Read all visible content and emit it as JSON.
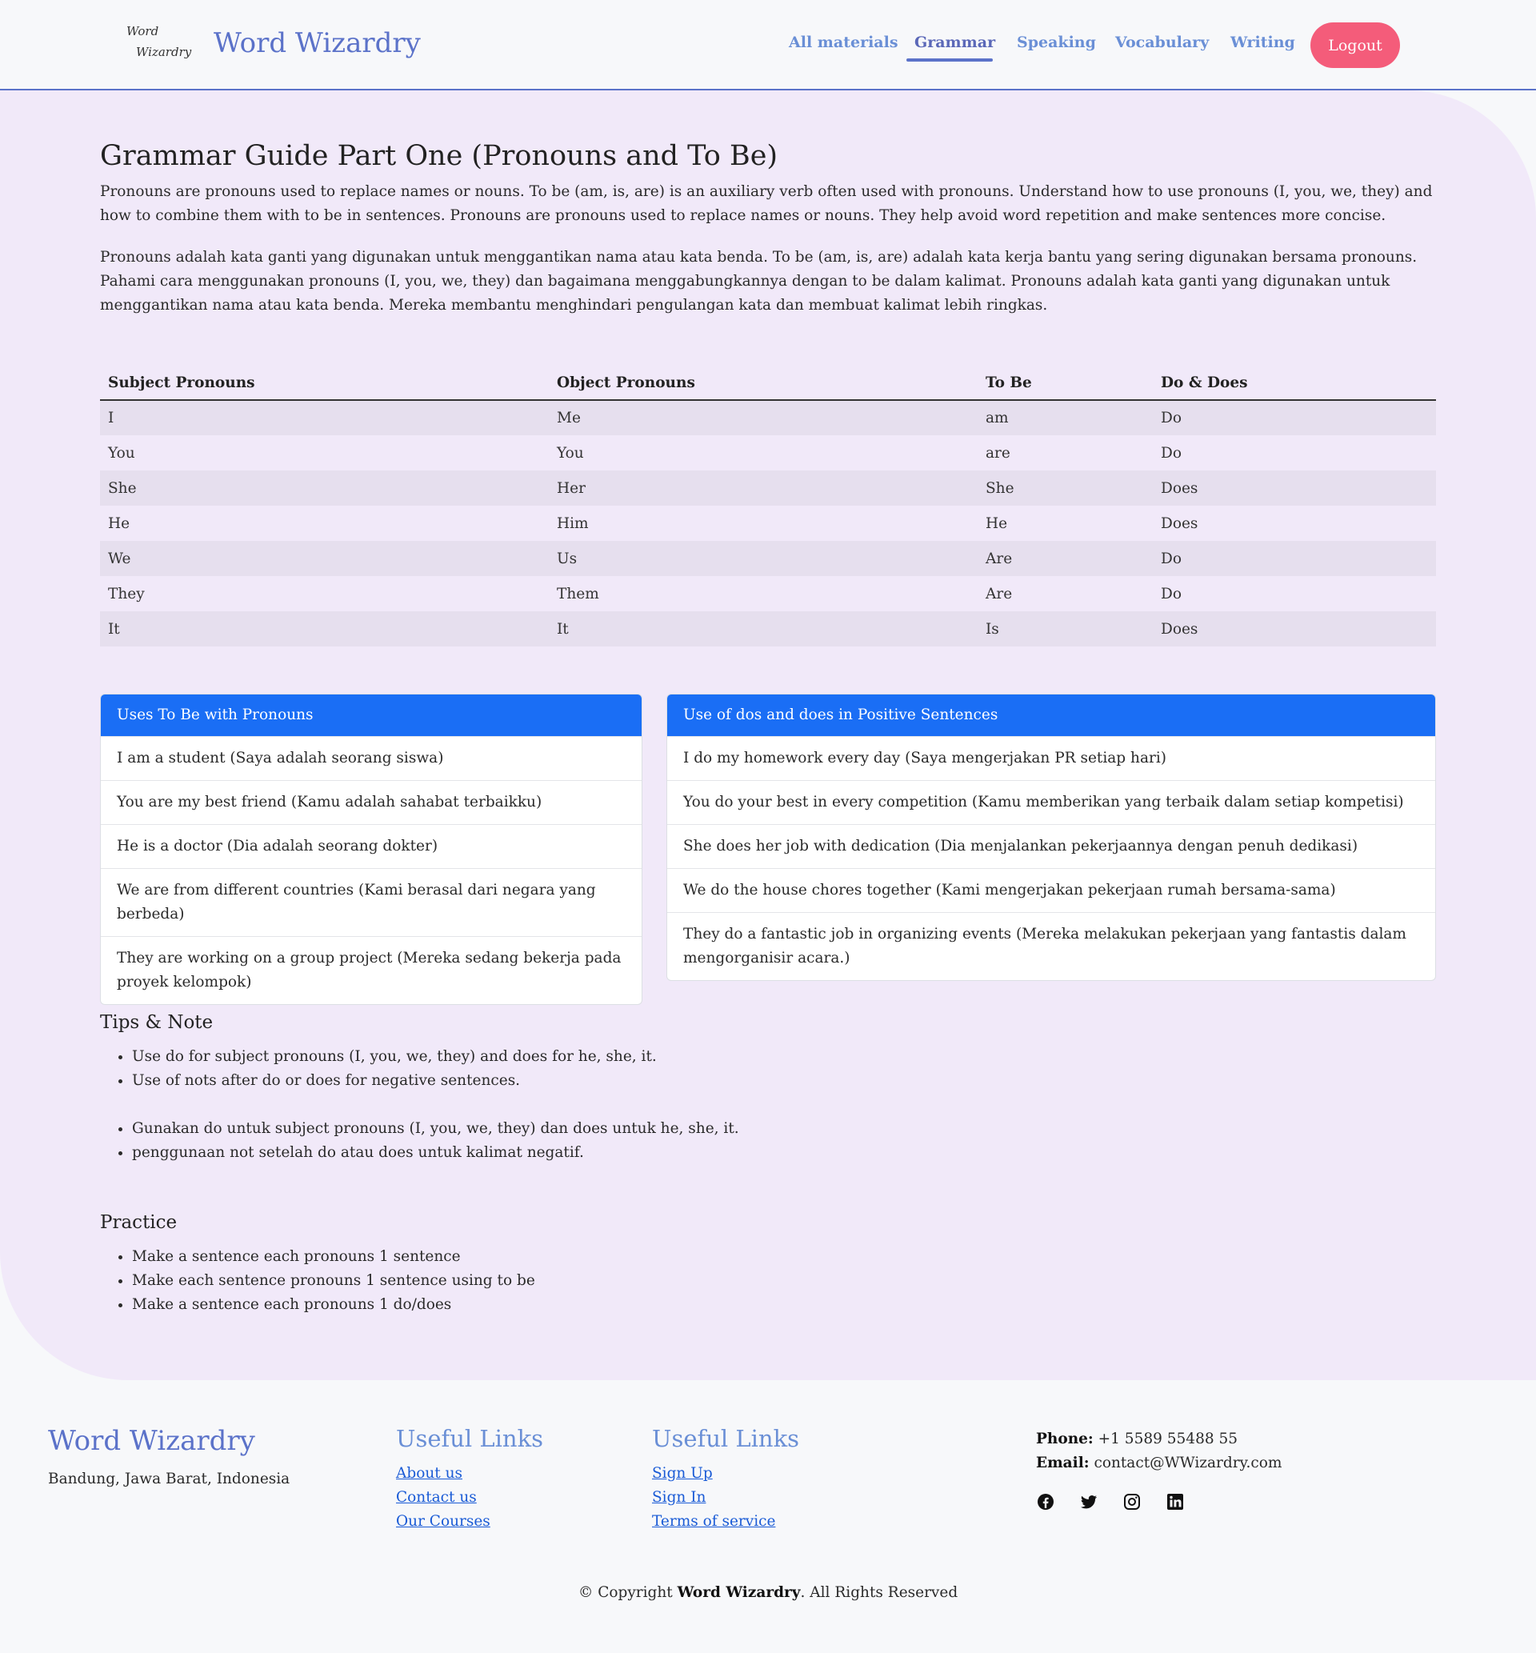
{
  "header": {
    "logo_line1": "Word",
    "logo_line2": "Wizardry",
    "brand": "Word Wizardry",
    "nav": [
      {
        "label": "All materials",
        "active": false
      },
      {
        "label": "Grammar",
        "active": true
      },
      {
        "label": "Speaking",
        "active": false
      },
      {
        "label": "Vocabulary",
        "active": false
      },
      {
        "label": "Writing",
        "active": false
      }
    ],
    "logout_label": "Logout"
  },
  "main": {
    "title": "Grammar Guide Part One (Pronouns and To Be)",
    "intro_en": "Pronouns are pronouns used to replace names or nouns. To be (am, is, are) is an auxiliary verb often used with pronouns. Understand how to use pronouns (I, you, we, they) and how to combine them with to be in sentences. Pronouns are pronouns used to replace names or nouns. They help avoid word repetition and make sentences more concise.",
    "intro_id": "Pronouns adalah kata ganti yang digunakan untuk menggantikan nama atau kata benda. To be (am, is, are) adalah kata kerja bantu yang sering digunakan bersama pronouns. Pahami cara menggunakan pronouns (I, you, we, they) dan bagaimana menggabungkannya dengan to be dalam kalimat. Pronouns adalah kata ganti yang digunakan untuk menggantikan nama atau kata benda. Mereka membantu menghindari pengulangan kata dan membuat kalimat lebih ringkas.",
    "table": {
      "headers": [
        "Subject Pronouns",
        "Object Pronouns",
        "To Be",
        "Do & Does"
      ],
      "rows": [
        [
          "I",
          "Me",
          "am",
          "Do"
        ],
        [
          "You",
          "You",
          "are",
          "Do"
        ],
        [
          "She",
          "Her",
          "She",
          "Does"
        ],
        [
          "He",
          "Him",
          "He",
          "Does"
        ],
        [
          "We",
          "Us",
          "Are",
          "Do"
        ],
        [
          "They",
          "Them",
          "Are",
          "Do"
        ],
        [
          "It",
          "It",
          "Is",
          "Does"
        ]
      ]
    },
    "card_left": {
      "title": "Uses To Be with Pronouns",
      "items": [
        "I am a student (Saya adalah seorang siswa)",
        "You are my best friend (Kamu adalah sahabat terbaikku)",
        "He is a doctor (Dia adalah seorang dokter)",
        "We are from different countries (Kami berasal dari negara yang berbeda)",
        "They are working on a group project (Mereka sedang bekerja pada proyek kelompok)"
      ]
    },
    "card_right": {
      "title": "Use of dos and does in Positive Sentences",
      "items": [
        "I do my homework every day (Saya mengerjakan PR setiap hari)",
        "You do your best in every competition (Kamu memberikan yang terbaik dalam setiap kompetisi)",
        "She does her job with dedication (Dia menjalankan pekerjaannya dengan penuh dedikasi)",
        "We do the house chores together (Kami mengerjakan pekerjaan rumah bersama-sama)",
        "They do a fantastic job in organizing events (Mereka melakukan pekerjaan yang fantastis dalam mengorganisir acara.)"
      ]
    },
    "tips": {
      "title": "Tips & Note",
      "en": [
        "Use do for subject pronouns (I, you, we, they) and does for he, she, it.",
        "Use of nots after do or does for negative sentences."
      ],
      "id": [
        "Gunakan do untuk subject pronouns (I, you, we, they) dan does untuk he, she, it.",
        "penggunaan not setelah do atau does untuk kalimat negatif."
      ]
    },
    "practice": {
      "title": "Practice",
      "items": [
        "Make a sentence each pronouns 1 sentence",
        "Make each sentence pronouns 1 sentence using to be",
        "Make a sentence each pronouns 1 do/does"
      ]
    }
  },
  "footer": {
    "brand": "Word Wizardry",
    "address": "Bandung, Jawa Barat, Indonesia",
    "links1": {
      "title": "Useful Links",
      "items": [
        "About us",
        "Contact us",
        "Our Courses"
      ]
    },
    "links2": {
      "title": "Useful Links",
      "items": [
        "Sign Up",
        "Sign In",
        "Terms of service"
      ]
    },
    "phone_label": "Phone:",
    "phone": "+1 5589 55488 55",
    "email_label": "Email:",
    "email": "contact@WWizardry.com",
    "social_icons": [
      "facebook-icon",
      "twitter-icon",
      "instagram-icon",
      "linkedin-icon"
    ],
    "copyright_prefix": "© Copyright",
    "copyright_brand": "Word Wizardry",
    "copyright_suffix": ". All Rights Reserved"
  }
}
